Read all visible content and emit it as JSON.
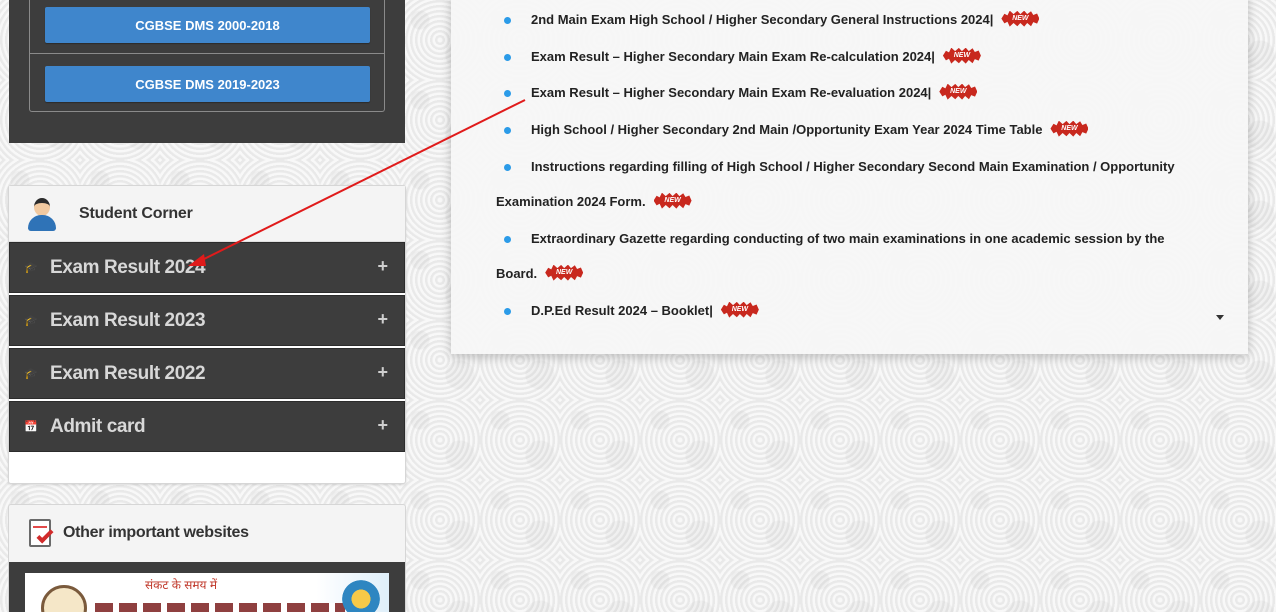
{
  "dms": {
    "buttons": [
      "CGBSE DMS 2000-2018",
      "CGBSE DMS 2019-2023"
    ]
  },
  "student_corner": {
    "title": "Student Corner",
    "items": [
      {
        "label": "Exam Result 2024",
        "icon": "graduation-cap-icon",
        "toggle": "+"
      },
      {
        "label": "Exam Result 2023",
        "icon": "graduation-cap-icon",
        "toggle": "+"
      },
      {
        "label": "Exam Result 2022",
        "icon": "graduation-cap-icon",
        "toggle": "+"
      },
      {
        "label": "Admit card",
        "icon": "calendar-icon",
        "toggle": "+"
      }
    ]
  },
  "other_websites": {
    "title": "Other important websites",
    "banner_text": "संकट के समय में"
  },
  "notices": {
    "badge_text": "NEW",
    "items": [
      {
        "line1": "2nd Main Exam High School / Higher Secondary General Instructions 2024|",
        "line2": ""
      },
      {
        "line1": "Exam Result – Higher Secondary Main Exam Re-calculation 2024|",
        "line2": ""
      },
      {
        "line1": "Exam Result – Higher Secondary Main Exam Re-evaluation 2024|",
        "line2": ""
      },
      {
        "line1": "High School / Higher Secondary 2nd Main /Opportunity Exam Year 2024 Time Table",
        "line2": ""
      },
      {
        "line1": "Instructions regarding filling of High School / Higher Secondary Second Main Examination / Opportunity",
        "line2": "Examination 2024 Form."
      },
      {
        "line1": "Extraordinary Gazette regarding conducting of two main examinations in one academic session by the",
        "line2": "Board."
      },
      {
        "line1": "D.P.Ed Result 2024 – Booklet|",
        "line2": ""
      }
    ]
  },
  "colors": {
    "dark_panel": "#3d3d3d",
    "dms_button": "#3f86cc",
    "bullet": "#2b9be8",
    "new_badge": "#c8281e",
    "annotation_arrow": "#e01b1b"
  }
}
